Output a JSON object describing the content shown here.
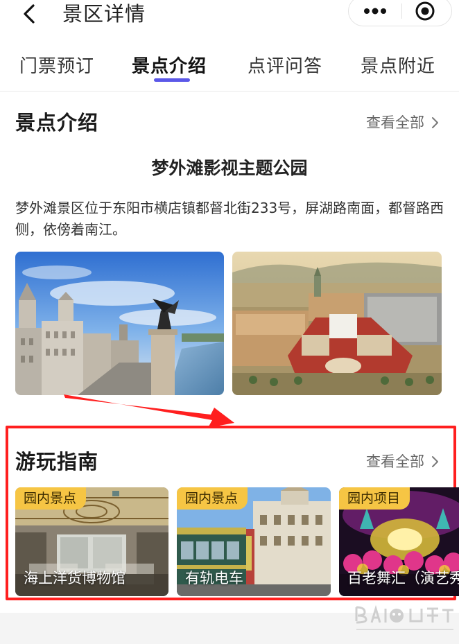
{
  "header": {
    "title": "景区详情"
  },
  "tabs": [
    {
      "label": "门票预订"
    },
    {
      "label": "景点介绍"
    },
    {
      "label": "点评问答"
    },
    {
      "label": "景点附近"
    }
  ],
  "intro": {
    "section_title": "景点介绍",
    "see_all": "查看全部",
    "attraction_name": "梦外滩影视主题公园",
    "description": "梦外滩景区位于东阳市横店镇都督北街233号，屏湖路南面，都督路西侧，依傍着南江。"
  },
  "guide": {
    "section_title": "游玩指南",
    "see_all": "查看全部",
    "cards": [
      {
        "badge": "园内景点",
        "label": "海上洋货博物馆"
      },
      {
        "badge": "园内景点",
        "label": "有轨电车"
      },
      {
        "badge": "园内项目",
        "label": "百老舞汇（演艺秀"
      }
    ]
  },
  "icons": {
    "back": "chevron-left-icon",
    "more": "more-dots-icon",
    "close": "target-circle-icon",
    "see_all": "chevron-right-icon"
  },
  "colors": {
    "accent": "#5b58e8",
    "badge": "#f6c544",
    "annotation": "#ff1f1f"
  }
}
